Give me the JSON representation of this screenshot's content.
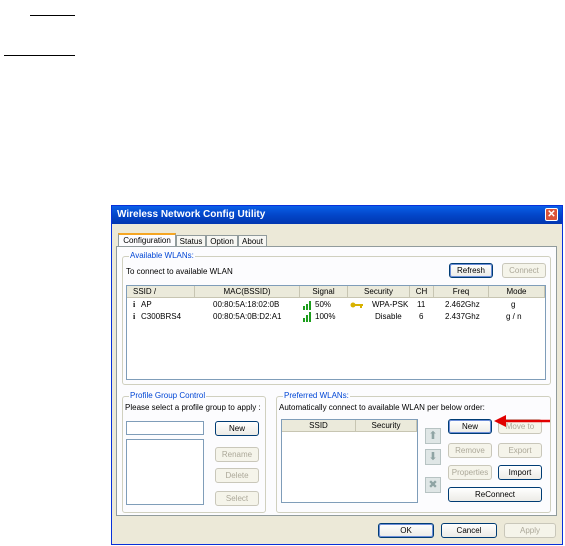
{
  "window": {
    "title": "Wireless Network Config Utility",
    "close_glyph": "✕"
  },
  "tabs": [
    "Configuration",
    "Status",
    "Option",
    "About"
  ],
  "available": {
    "legend": "Available WLANs:",
    "instruction": "To connect to available WLAN",
    "refresh_label": "Refresh",
    "connect_label": "Connect",
    "columns": [
      "SSID  /",
      "MAC(BSSID)",
      "Signal",
      "Security",
      "CH",
      "Freq",
      "Mode"
    ],
    "rows": [
      {
        "icon": "i",
        "ssid": "AP",
        "mac": "00:80:5A:18:02:0B",
        "signal": "50%",
        "security": "WPA-PSK",
        "ch": "11",
        "freq": "2.462Ghz",
        "mode": "g",
        "locked": true
      },
      {
        "icon": "i",
        "ssid": "C300BRS4",
        "mac": "00:80:5A:0B:D2:A1",
        "signal": "100%",
        "security": "Disable",
        "ch": "6",
        "freq": "2.437Ghz",
        "mode": "g / n",
        "locked": false
      }
    ]
  },
  "profile_group": {
    "legend": "Profile Group Control",
    "instruction": "Please select a profile group to apply :",
    "input_value": "",
    "new_label": "New",
    "rename_label": "Rename",
    "delete_label": "Delete",
    "select_label": "Select"
  },
  "preferred": {
    "legend": "Preferred WLANs:",
    "instruction": "Automatically connect to available WLAN per below order:",
    "columns": [
      "SSID",
      "Security"
    ],
    "new_label": "New",
    "move_to_label": "Move to",
    "remove_label": "Remove",
    "export_label": "Export",
    "properties_label": "Properties",
    "import_label": "Import",
    "reconnect_label": "ReConnect"
  },
  "footer": {
    "ok_label": "OK",
    "cancel_label": "Cancel",
    "apply_label": "Apply"
  },
  "colors": {
    "title_bar": "#0a5fe8",
    "legend_text": "#0046d5",
    "annotation_arrow": "#e10000",
    "signal_green": "#1c9e1c",
    "key_gold": "#d8b200"
  }
}
